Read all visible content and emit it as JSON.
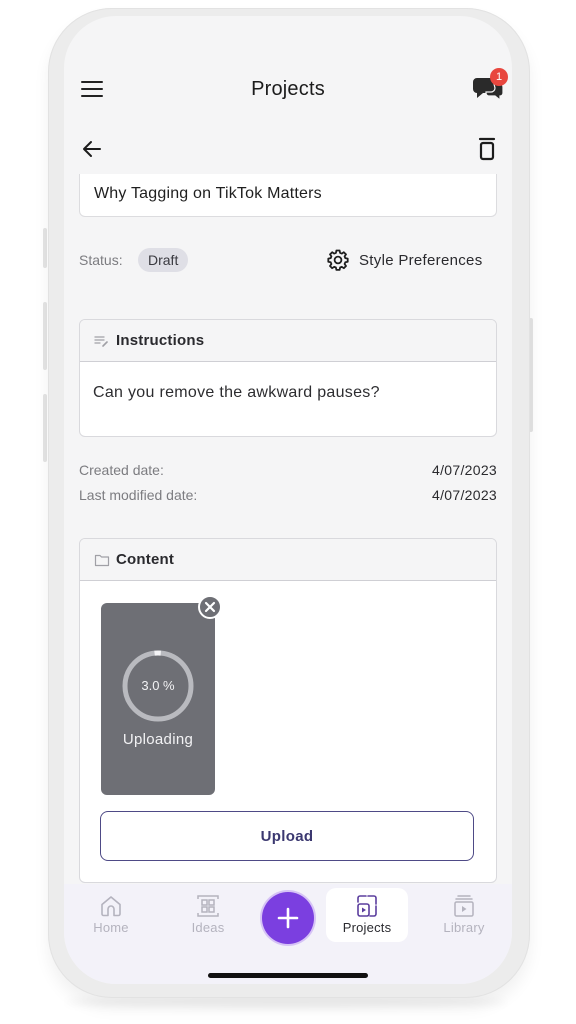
{
  "header": {
    "title": "Projects",
    "notification_count": "1"
  },
  "project": {
    "title": "Why Tagging on TikTok Matters",
    "status_label": "Status:",
    "status_value": "Draft",
    "style_preferences_label": "Style Preferences"
  },
  "instructions": {
    "header": "Instructions",
    "text": "Can you remove the awkward pauses?"
  },
  "dates": {
    "created_label": "Created date:",
    "created_value": "4/07/2023",
    "modified_label": "Last modified date:",
    "modified_value": "4/07/2023"
  },
  "content": {
    "header": "Content",
    "upload_progress_text": "3.0 %",
    "upload_progress_fraction": 0.03,
    "uploading_label": "Uploading",
    "upload_button": "Upload"
  },
  "bottom_nav": {
    "items": [
      {
        "label": "Home",
        "icon": "home-icon",
        "active": false
      },
      {
        "label": "Ideas",
        "icon": "ideas-grid-icon",
        "active": false
      },
      {
        "label": "Projects",
        "icon": "projects-icon",
        "active": true
      },
      {
        "label": "Library",
        "icon": "library-icon",
        "active": false
      }
    ],
    "fab_icon": "plus-icon"
  },
  "colors": {
    "accent": "#7b3fe0",
    "badge": "#e8473f",
    "upload_button_border": "#4e4a86",
    "tile": "#6e6f75"
  }
}
